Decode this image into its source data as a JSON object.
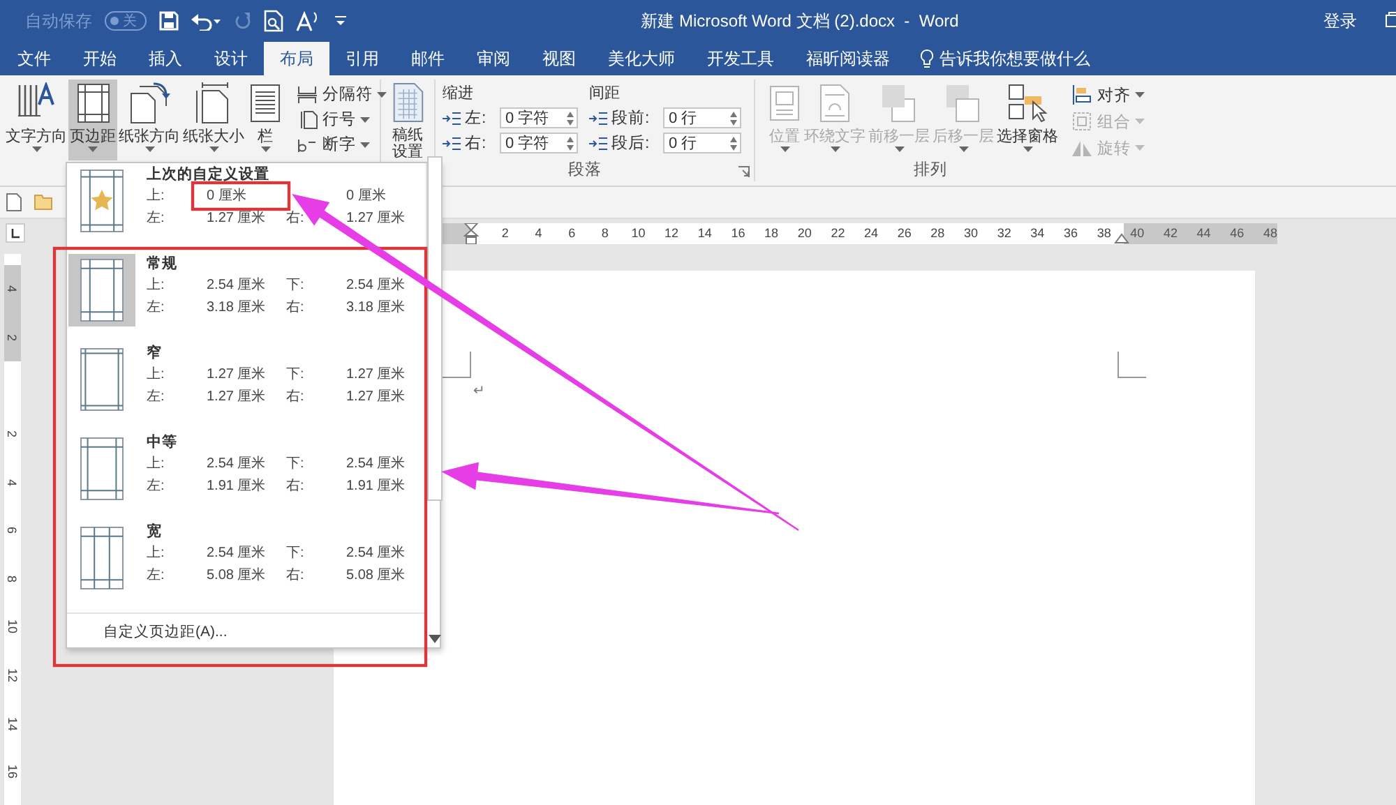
{
  "title_bar": {
    "autosave": {
      "label": "自动保存",
      "state_text": "关",
      "on": false
    },
    "title": "新建 Microsoft Word 文档 (2).docx  -  Word",
    "sign_in": "登录"
  },
  "tabs": [
    {
      "label": "文件",
      "selected": false
    },
    {
      "label": "开始",
      "selected": false
    },
    {
      "label": "插入",
      "selected": false
    },
    {
      "label": "设计",
      "selected": false
    },
    {
      "label": "布局",
      "selected": true
    },
    {
      "label": "引用",
      "selected": false
    },
    {
      "label": "邮件",
      "selected": false
    },
    {
      "label": "审阅",
      "selected": false
    },
    {
      "label": "视图",
      "selected": false
    },
    {
      "label": "美化大师",
      "selected": false
    },
    {
      "label": "开发工具",
      "selected": false
    },
    {
      "label": "福昕阅读器",
      "selected": false
    }
  ],
  "tell_me": "告诉我你想要做什么",
  "ribbon": {
    "page_setup": {
      "buttons": [
        {
          "label": "文字方向",
          "kind": "text-direction",
          "selected": false
        },
        {
          "label": "页边距",
          "kind": "margins",
          "selected": true
        },
        {
          "label": "纸张方向",
          "kind": "orientation",
          "selected": false
        },
        {
          "label": "纸张大小",
          "kind": "size",
          "selected": false
        },
        {
          "label": "栏",
          "kind": "columns",
          "selected": false
        }
      ],
      "small_buttons": [
        {
          "label": "分隔符",
          "kind": "breaks"
        },
        {
          "label": "行号",
          "kind": "line-numbers"
        },
        {
          "label": "断字",
          "kind": "hyphenation"
        }
      ]
    },
    "draft": {
      "label_lines": [
        "稿纸",
        "设置"
      ]
    },
    "paragraph": {
      "title": "段落",
      "indent_label": "缩进",
      "spacing_label": "间距",
      "indent": [
        {
          "label": "左:",
          "value": "0 字符"
        },
        {
          "label": "右:",
          "value": "0 字符"
        }
      ],
      "spacing": [
        {
          "label": "段前:",
          "value": "0 行"
        },
        {
          "label": "段后:",
          "value": "0 行"
        }
      ]
    },
    "arrange": {
      "title": "排列",
      "buttons": [
        {
          "label": "位置",
          "kind": "position",
          "disabled": true
        },
        {
          "label": "环绕文字",
          "kind": "wrap",
          "disabled": true
        },
        {
          "label": "前移一层",
          "kind": "forward",
          "disabled": true
        },
        {
          "label": "后移一层",
          "kind": "backward",
          "disabled": true
        },
        {
          "label": "选择窗格",
          "kind": "selection-pane",
          "disabled": false
        }
      ],
      "small_buttons": [
        {
          "label": "对齐",
          "kind": "align",
          "disabled": false
        },
        {
          "label": "组合",
          "kind": "group",
          "disabled": true
        },
        {
          "label": "旋转",
          "kind": "rotate",
          "disabled": true
        }
      ]
    }
  },
  "margins_gallery": {
    "items": [
      {
        "name": "上次的自定义设置",
        "kind": "custom",
        "selected": false,
        "values": [
          {
            "label": "上:",
            "value": "0 厘米"
          },
          {
            "value": "0 厘米"
          },
          {
            "label": "左:",
            "value": "1.27 厘米"
          },
          {
            "label": "右:",
            "value": "1.27 厘米"
          }
        ]
      },
      {
        "name": "常规",
        "kind": "normal",
        "selected": true,
        "values": [
          {
            "label": "上:",
            "value": "2.54 厘米"
          },
          {
            "label": "下:",
            "value": "2.54 厘米"
          },
          {
            "label": "左:",
            "value": "3.18 厘米"
          },
          {
            "label": "右:",
            "value": "3.18 厘米"
          }
        ]
      },
      {
        "name": "窄",
        "kind": "narrow",
        "selected": false,
        "values": [
          {
            "label": "上:",
            "value": "1.27 厘米"
          },
          {
            "label": "下:",
            "value": "1.27 厘米"
          },
          {
            "label": "左:",
            "value": "1.27 厘米"
          },
          {
            "label": "右:",
            "value": "1.27 厘米"
          }
        ]
      },
      {
        "name": "中等",
        "kind": "moderate",
        "selected": false,
        "values": [
          {
            "label": "上:",
            "value": "2.54 厘米"
          },
          {
            "label": "下:",
            "value": "2.54 厘米"
          },
          {
            "label": "左:",
            "value": "1.91 厘米"
          },
          {
            "label": "右:",
            "value": "1.91 厘米"
          }
        ]
      },
      {
        "name": "宽",
        "kind": "wide",
        "selected": false,
        "values": [
          {
            "label": "上:",
            "value": "2.54 厘米"
          },
          {
            "label": "下:",
            "value": "2.54 厘米"
          },
          {
            "label": "左:",
            "value": "5.08 厘米"
          },
          {
            "label": "右:",
            "value": "5.08 厘米"
          }
        ]
      }
    ],
    "footer": "自定义页边距(A)..."
  },
  "horizontal_ruler": [
    {
      "label": "2",
      "margin": false
    },
    {
      "label": "4",
      "margin": false
    },
    {
      "label": "6",
      "margin": false
    },
    {
      "label": "8",
      "margin": false
    },
    {
      "label": "10",
      "margin": false
    },
    {
      "label": "12",
      "margin": false
    },
    {
      "label": "14",
      "margin": false
    },
    {
      "label": "16",
      "margin": false
    },
    {
      "label": "18",
      "margin": false
    },
    {
      "label": "20",
      "margin": false
    },
    {
      "label": "22",
      "margin": false
    },
    {
      "label": "24",
      "margin": false
    },
    {
      "label": "26",
      "margin": false
    },
    {
      "label": "28",
      "margin": false
    },
    {
      "label": "30",
      "margin": false
    },
    {
      "label": "32",
      "margin": false
    },
    {
      "label": "34",
      "margin": false
    },
    {
      "label": "36",
      "margin": false
    },
    {
      "label": "38",
      "margin": false
    },
    {
      "label": "40",
      "margin": true
    },
    {
      "label": "42",
      "margin": true
    },
    {
      "label": "44",
      "margin": true
    },
    {
      "label": "46",
      "margin": true
    },
    {
      "label": "48",
      "margin": true
    }
  ],
  "vertical_ruler": [
    {
      "label": "4",
      "margin": true
    },
    {
      "label": "2",
      "margin": true
    },
    {
      "label": "2",
      "margin": false
    },
    {
      "label": "4",
      "margin": false
    },
    {
      "label": "6",
      "margin": false
    },
    {
      "label": "8",
      "margin": false
    },
    {
      "label": "10",
      "margin": false
    },
    {
      "label": "12",
      "margin": false
    },
    {
      "label": "14",
      "margin": false
    },
    {
      "label": "16",
      "margin": false
    }
  ],
  "document": {
    "paragraph_mark": "↵"
  },
  "annotations": [
    {
      "kind": "box"
    },
    {
      "kind": "box"
    },
    {
      "kind": "arrow"
    },
    {
      "kind": "arrow"
    }
  ]
}
